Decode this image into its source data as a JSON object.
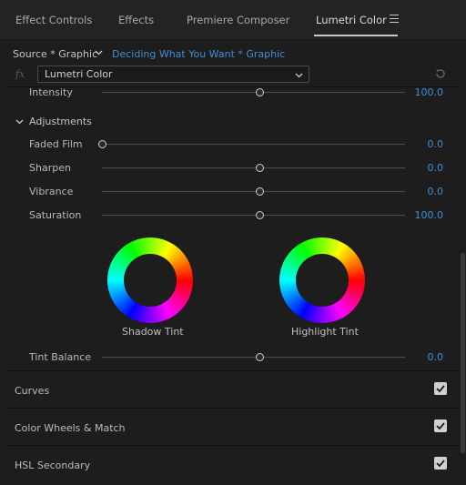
{
  "tabs": [
    {
      "label": "Effect Controls"
    },
    {
      "label": "Effects"
    },
    {
      "label": "Premiere Composer"
    },
    {
      "label": "Lumetri Color",
      "active": true
    }
  ],
  "menu_icon": "hamburger-menu-icon",
  "source": {
    "label": "Source * Graphic",
    "clip": "Deciding What You Want * Graphic"
  },
  "effect": {
    "fx_label": "fx",
    "selected": "Lumetri Color",
    "reset_icon": "reset-icon"
  },
  "intensity": {
    "label": "Intensity",
    "value": "100.0",
    "level": 0.52
  },
  "adjustments": {
    "label": "Adjustments",
    "props": [
      {
        "label": "Faded Film",
        "value": "0.0",
        "level": 0.0
      },
      {
        "label": "Sharpen",
        "value": "0.0",
        "level": 0.52
      },
      {
        "label": "Vibrance",
        "value": "0.0",
        "level": 0.52
      },
      {
        "label": "Saturation",
        "value": "100.0",
        "level": 0.52
      }
    ],
    "wheels": [
      {
        "label": "Shadow Tint"
      },
      {
        "label": "Highlight Tint"
      }
    ],
    "tint_balance": {
      "label": "Tint Balance",
      "value": "0.0",
      "level": 0.52
    }
  },
  "groups": [
    {
      "label": "Curves",
      "checked": true
    },
    {
      "label": "Color Wheels & Match",
      "checked": true
    },
    {
      "label": "HSL Secondary",
      "checked": true
    }
  ],
  "colors": {
    "accent": "#3d8fd9",
    "background": "#1d1d1d"
  }
}
